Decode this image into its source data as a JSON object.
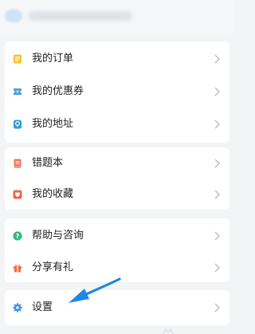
{
  "menu": {
    "group1": [
      {
        "label": "我的订单",
        "icon": "order-icon",
        "color": "#f5c02e"
      },
      {
        "label": "我的优惠券",
        "icon": "coupon-icon",
        "color": "#4a9edb"
      },
      {
        "label": "我的地址",
        "icon": "location-icon",
        "color": "#2f9bd6"
      }
    ],
    "group2": [
      {
        "label": "错题本",
        "icon": "notebook-icon",
        "color": "#e8765a"
      },
      {
        "label": "我的收藏",
        "icon": "heart-icon",
        "color": "#e8674f"
      }
    ],
    "group3": [
      {
        "label": "帮助与咨询",
        "icon": "help-icon",
        "color": "#34b880"
      },
      {
        "label": "分享有礼",
        "icon": "gift-icon",
        "color": "#ef6c48"
      }
    ],
    "group4": [
      {
        "label": "设置",
        "icon": "settings-icon",
        "color": "#3a8fd8"
      }
    ]
  },
  "annotation": {
    "icon": "pointer-arrow-icon",
    "color": "#1e88e5"
  },
  "colors": {
    "chevron": "#b9bcc1",
    "background": "#f3f4f6",
    "card": "#ffffff"
  }
}
